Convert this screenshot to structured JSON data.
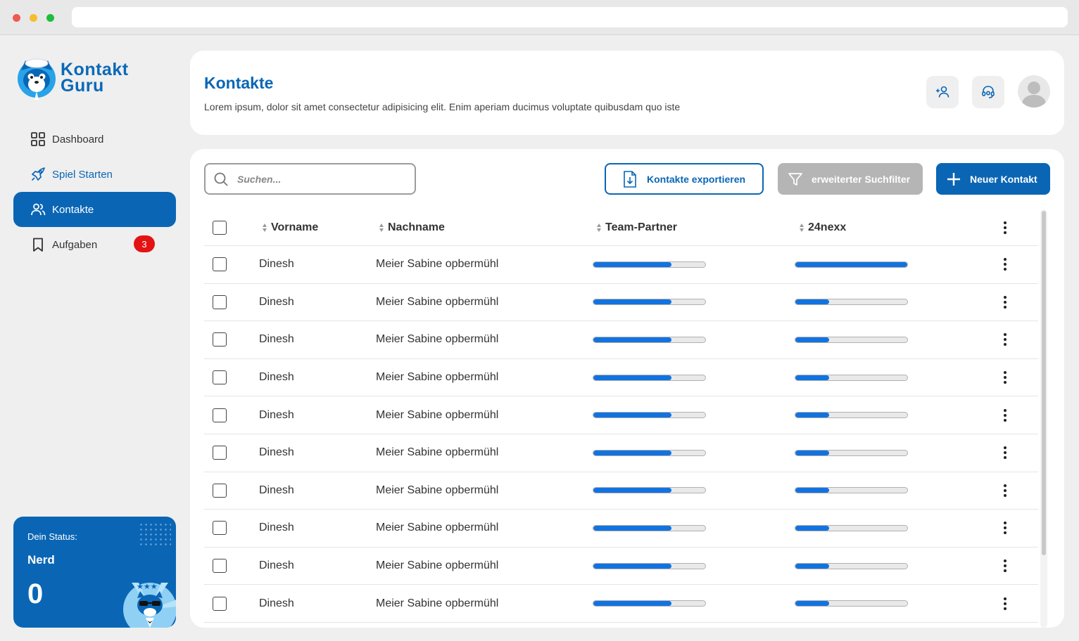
{
  "app": {
    "logo_line1": "Kontakt",
    "logo_line2": "Guru",
    "accent_color": "#0a66b5"
  },
  "sidebar": {
    "items": [
      {
        "label": "Dashboard",
        "icon": "grid-icon"
      },
      {
        "label": "Spiel Starten",
        "icon": "rocket-icon"
      },
      {
        "label": "Kontakte",
        "icon": "users-icon",
        "active": true
      },
      {
        "label": "Aufgaben",
        "icon": "bookmark-icon",
        "badge": "3"
      }
    ]
  },
  "status": {
    "label": "Dein Status:",
    "level": "Nerd",
    "points": "0"
  },
  "header": {
    "title": "Kontakte",
    "description": "Lorem ipsum, dolor sit amet consectetur adipisicing elit. Enim aperiam ducimus voluptate quibusdam quo iste",
    "icons": [
      "add-user-icon",
      "headset-icon",
      "user-avatar-icon"
    ]
  },
  "toolbar": {
    "search_placeholder": "Suchen...",
    "export_label": "Kontakte exportieren",
    "filter_label": "erweiterter Suchfilter",
    "new_label": "Neuer Kontakt"
  },
  "table": {
    "columns": [
      "Vorname",
      "Nachname",
      "Team-Partner",
      "24nexx"
    ],
    "rows": [
      {
        "vorname": "Dinesh",
        "nachname": "Meier Sabine opbermühl",
        "team_partner": 0.7,
        "nexx": 1.0
      },
      {
        "vorname": "Dinesh",
        "nachname": "Meier Sabine opbermühl",
        "team_partner": 0.7,
        "nexx": 0.3
      },
      {
        "vorname": "Dinesh",
        "nachname": "Meier Sabine opbermühl",
        "team_partner": 0.7,
        "nexx": 0.3
      },
      {
        "vorname": "Dinesh",
        "nachname": "Meier Sabine opbermühl",
        "team_partner": 0.7,
        "nexx": 0.3
      },
      {
        "vorname": "Dinesh",
        "nachname": "Meier Sabine opbermühl",
        "team_partner": 0.7,
        "nexx": 0.3
      },
      {
        "vorname": "Dinesh",
        "nachname": "Meier Sabine opbermühl",
        "team_partner": 0.7,
        "nexx": 0.3
      },
      {
        "vorname": "Dinesh",
        "nachname": "Meier Sabine opbermühl",
        "team_partner": 0.7,
        "nexx": 0.3
      },
      {
        "vorname": "Dinesh",
        "nachname": "Meier Sabine opbermühl",
        "team_partner": 0.7,
        "nexx": 0.3
      },
      {
        "vorname": "Dinesh",
        "nachname": "Meier Sabine opbermühl",
        "team_partner": 0.7,
        "nexx": 0.3
      },
      {
        "vorname": "Dinesh",
        "nachname": "Meier Sabine opbermühl",
        "team_partner": 0.7,
        "nexx": 0.3
      }
    ]
  }
}
